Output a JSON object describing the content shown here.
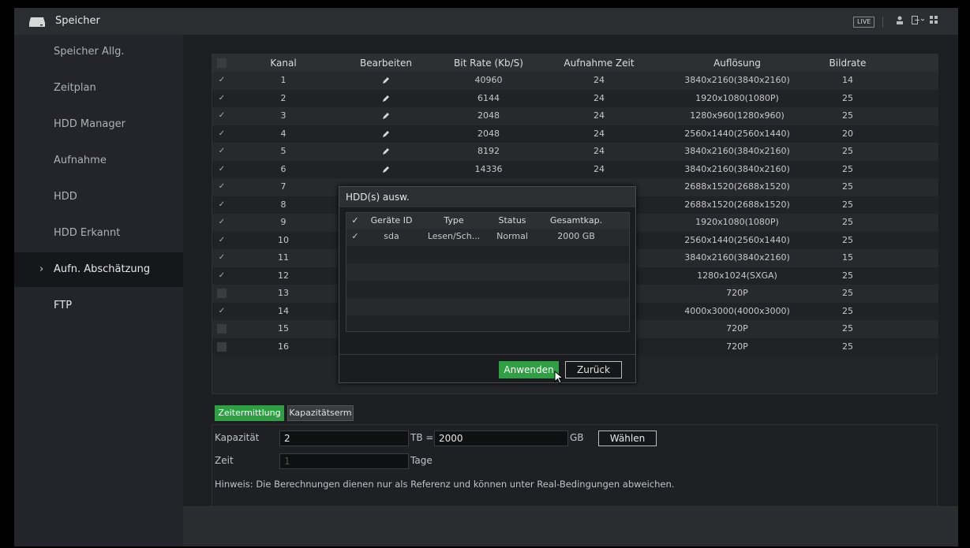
{
  "app": {
    "title": "Speicher",
    "live_label": "LIVE"
  },
  "sidebar": {
    "items": [
      {
        "label": "Speicher Allg."
      },
      {
        "label": "Zeitplan"
      },
      {
        "label": "HDD Manager"
      },
      {
        "label": "Aufnahme"
      },
      {
        "label": "HDD"
      },
      {
        "label": "HDD Erkannt"
      },
      {
        "label": "Aufn. Abschätzung",
        "chevron": "›"
      },
      {
        "label": "FTP"
      }
    ]
  },
  "table": {
    "headers": [
      "Kanal",
      "Bearbeiten",
      "Bit Rate (Kb/S)",
      "Aufnahme Zeit",
      "Auflösung",
      "Bildrate"
    ],
    "rows": [
      {
        "check": "✓",
        "kanal": "1",
        "bitrate": "40960",
        "zeit": "24",
        "aufl": "3840x2160(3840x2160)",
        "bild": "14"
      },
      {
        "check": "✓",
        "kanal": "2",
        "bitrate": "6144",
        "zeit": "24",
        "aufl": "1920x1080(1080P)",
        "bild": "25"
      },
      {
        "check": "✓",
        "kanal": "3",
        "bitrate": "2048",
        "zeit": "24",
        "aufl": "1280x960(1280x960)",
        "bild": "25"
      },
      {
        "check": "✓",
        "kanal": "4",
        "bitrate": "2048",
        "zeit": "24",
        "aufl": "2560x1440(2560x1440)",
        "bild": "20"
      },
      {
        "check": "✓",
        "kanal": "5",
        "bitrate": "8192",
        "zeit": "24",
        "aufl": "3840x2160(3840x2160)",
        "bild": "25"
      },
      {
        "check": "✓",
        "kanal": "6",
        "bitrate": "14336",
        "zeit": "24",
        "aufl": "3840x2160(3840x2160)",
        "bild": "25"
      },
      {
        "check": "✓",
        "kanal": "7",
        "bitrate": "",
        "zeit": "",
        "aufl": "2688x1520(2688x1520)",
        "bild": "25"
      },
      {
        "check": "✓",
        "kanal": "8",
        "bitrate": "",
        "zeit": "",
        "aufl": "2688x1520(2688x1520)",
        "bild": "25"
      },
      {
        "check": "✓",
        "kanal": "9",
        "bitrate": "",
        "zeit": "",
        "aufl": "1920x1080(1080P)",
        "bild": "25"
      },
      {
        "check": "✓",
        "kanal": "10",
        "bitrate": "",
        "zeit": "",
        "aufl": "2560x1440(2560x1440)",
        "bild": "25"
      },
      {
        "check": "✓",
        "kanal": "11",
        "bitrate": "",
        "zeit": "",
        "aufl": "3840x2160(3840x2160)",
        "bild": "15"
      },
      {
        "check": "✓",
        "kanal": "12",
        "bitrate": "",
        "zeit": "",
        "aufl": "1280x1024(SXGA)",
        "bild": "25"
      },
      {
        "check": "",
        "kanal": "13",
        "bitrate": "",
        "zeit": "",
        "aufl": "720P",
        "bild": "25"
      },
      {
        "check": "✓",
        "kanal": "14",
        "bitrate": "",
        "zeit": "",
        "aufl": "4000x3000(4000x3000)",
        "bild": "25"
      },
      {
        "check": "",
        "kanal": "15",
        "bitrate": "",
        "zeit": "",
        "aufl": "720P",
        "bild": "25"
      },
      {
        "check": "",
        "kanal": "16",
        "bitrate": "",
        "zeit": "",
        "aufl": "720P",
        "bild": "25"
      }
    ]
  },
  "tabs": {
    "time": "Zeitermittlung",
    "capacity": "Kapazitätserm"
  },
  "form": {
    "capacity_label": "Kapazität",
    "capacity_value": "2",
    "tb_label": "TB =",
    "gb_value": "2000",
    "gb_label": "GB",
    "choose_label": "Wählen",
    "time_label": "Zeit",
    "time_value": "1",
    "days_label": "Tage",
    "hint": "Hinweis: Die Berechnungen dienen nur als Referenz und können unter Real-Bedingungen abweichen."
  },
  "dialog": {
    "title": "HDD(s) ausw.",
    "headers": {
      "check": "✓",
      "id": "Geräte ID",
      "type": "Type",
      "status": "Status",
      "capacity": "Gesamtkap."
    },
    "row": {
      "check": "✓",
      "id": "sda",
      "type": "Lesen/Sch...",
      "status": "Normal",
      "capacity": "2000 GB"
    },
    "apply_label": "Anwenden",
    "back_label": "Zurück"
  },
  "colors": {
    "accent": "#2ea043",
    "background": "#1c1e22",
    "sidebar": "#23252a"
  }
}
